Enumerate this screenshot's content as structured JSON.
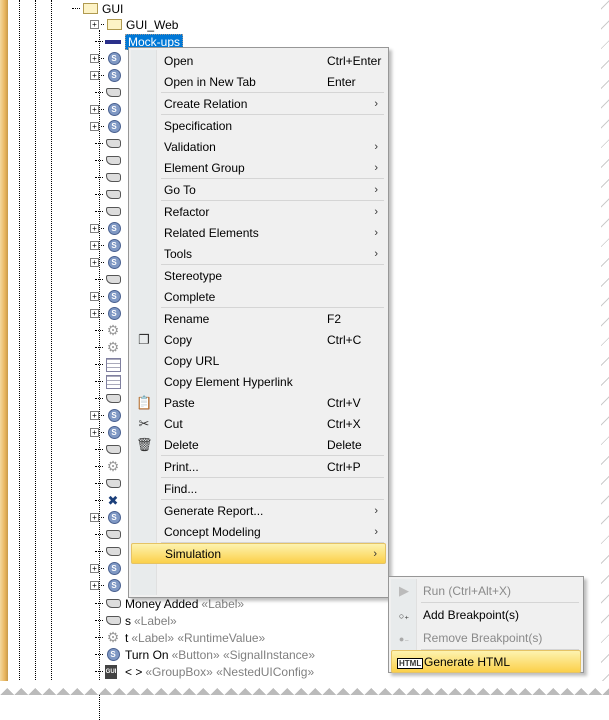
{
  "tree": {
    "root": "GUI",
    "items": [
      {
        "label": "GUI_Web",
        "icon": "folder",
        "expandable": true
      },
      {
        "label": "Mock-ups",
        "icon": "mockup",
        "selected": true
      }
    ],
    "hidden_rows": [
      "s",
      "s",
      "label",
      "s",
      "s",
      "label",
      "label",
      "label",
      "label",
      "label",
      "s",
      "s",
      "s",
      "label",
      "s",
      "s",
      "gear",
      "gear",
      "chart",
      "chart",
      "label",
      "s",
      "s",
      "label",
      "gear",
      "label",
      "tools",
      "s",
      "label",
      "label",
      "s",
      "s"
    ],
    "bottom_items": [
      {
        "label": "Money Added",
        "stereo": "«Label»",
        "icon": "label"
      },
      {
        "label": "s",
        "stereo": "«Label»",
        "icon": "label"
      },
      {
        "label": "t",
        "stereo": "«Label» «RuntimeValue»",
        "icon": "gear"
      },
      {
        "label": "Turn On",
        "stereo": "«Button» «SignalInstance»",
        "icon": "s"
      },
      {
        "label": "< >",
        "stereo": "«GroupBox» «NestedUIConfig»",
        "icon": "gui"
      }
    ]
  },
  "menu": [
    {
      "label": "Open",
      "shortcut": "Ctrl+Enter"
    },
    {
      "label": "Open in New Tab",
      "shortcut": "Enter"
    },
    {
      "sep": true
    },
    {
      "label": "Create Relation",
      "submenu": true
    },
    {
      "sep": true
    },
    {
      "label": "Specification"
    },
    {
      "label": "Validation",
      "submenu": true
    },
    {
      "label": "Element Group",
      "submenu": true
    },
    {
      "sep": true
    },
    {
      "label": "Go To",
      "submenu": true
    },
    {
      "sep": true
    },
    {
      "label": "Refactor",
      "submenu": true
    },
    {
      "label": "Related Elements",
      "submenu": true
    },
    {
      "label": "Tools",
      "submenu": true
    },
    {
      "sep": true
    },
    {
      "label": "Stereotype"
    },
    {
      "label": "Complete"
    },
    {
      "sep": true
    },
    {
      "label": "Rename",
      "shortcut": "F2"
    },
    {
      "label": "Copy",
      "shortcut": "Ctrl+C",
      "icon": "copy"
    },
    {
      "label": "Copy URL"
    },
    {
      "label": "Copy Element Hyperlink"
    },
    {
      "label": "Paste",
      "shortcut": "Ctrl+V",
      "icon": "paste"
    },
    {
      "label": "Cut",
      "shortcut": "Ctrl+X",
      "icon": "cut"
    },
    {
      "label": "Delete",
      "shortcut": "Delete",
      "icon": "trash"
    },
    {
      "sep": true
    },
    {
      "label": "Print...",
      "shortcut": "Ctrl+P"
    },
    {
      "sep": true
    },
    {
      "label": "Find..."
    },
    {
      "sep": true
    },
    {
      "label": "Generate Report...",
      "submenu": true
    },
    {
      "label": "Concept Modeling",
      "submenu": true
    },
    {
      "sep": true
    },
    {
      "label": "Simulation",
      "submenu": true,
      "highlighted": true
    }
  ],
  "submenu": [
    {
      "label": "Run (Ctrl+Alt+X)",
      "disabled": true,
      "icon": "play"
    },
    {
      "sep": true
    },
    {
      "label": "Add Breakpoint(s)",
      "icon": "breakpoint-add"
    },
    {
      "label": "Remove Breakpoint(s)",
      "disabled": true,
      "icon": "breakpoint-remove"
    },
    {
      "sep": true
    },
    {
      "label": "Generate HTML",
      "icon": "html",
      "highlighted": true
    }
  ],
  "colors": {
    "selection": "#0078d7",
    "highlight": "#fbd04a"
  }
}
